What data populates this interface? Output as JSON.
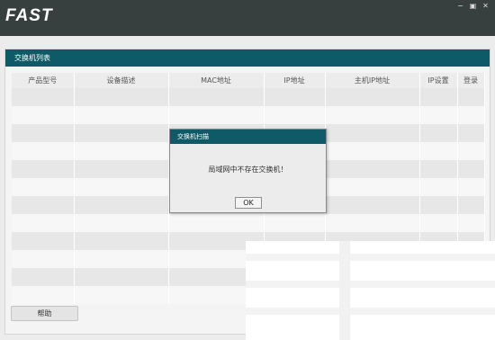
{
  "app": {
    "logo": "FAST",
    "window_controls": [
      "minimize-icon",
      "restore-icon",
      "close-icon"
    ]
  },
  "panel": {
    "title": "交换机列表",
    "columns": [
      "产品型号",
      "设备描述",
      "MAC地址",
      "IP地址",
      "主机IP地址",
      "IP设置",
      "登录"
    ],
    "row_count": 12,
    "help_label": "帮助"
  },
  "dialog": {
    "title": "交换机扫描",
    "message": "局域网中不存在交换机！",
    "ok_label": "OK"
  },
  "colors": {
    "titlebar": "#38403f",
    "accent": "#0e5a66",
    "background": "#ececec"
  }
}
